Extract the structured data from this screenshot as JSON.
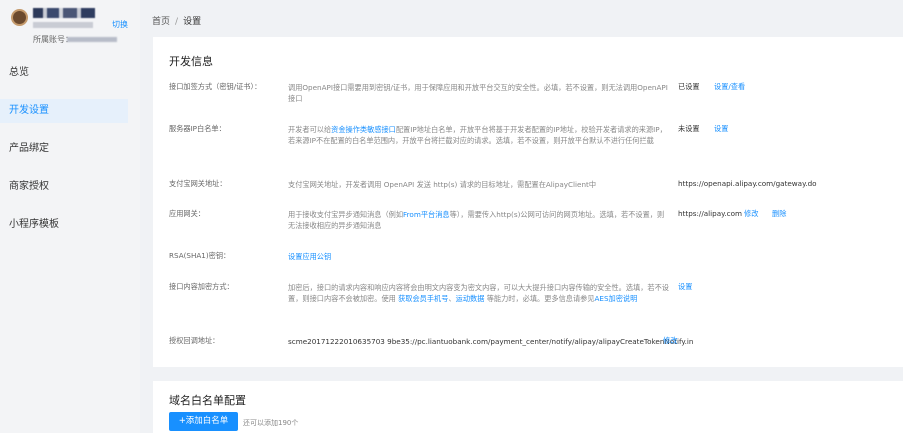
{
  "profile": {
    "switch_label": "切换",
    "account_label": "所属账号："
  },
  "nav": {
    "items": [
      {
        "label": "总览",
        "active": false
      },
      {
        "label": "开发设置",
        "active": true
      },
      {
        "label": "产品绑定",
        "active": false
      },
      {
        "label": "商家授权",
        "active": false
      },
      {
        "label": "小程序模板",
        "active": false
      }
    ]
  },
  "breadcrumb": {
    "home": "首页",
    "separator": "/",
    "current": "设置"
  },
  "dev_info": {
    "title": "开发信息",
    "rows": {
      "sign": {
        "label": "接口加签方式（密钥/证书）：",
        "desc": "调用OpenAPI接口需要用到密钥/证书，用于保障应用和开放平台交互的安全性。必填，若不设置，则无法调用OpenAPI接口",
        "status": "已设置",
        "action": "设置/查看"
      },
      "ip": {
        "label": "服务器IP白名单：",
        "desc_pre": "开发者可以给",
        "desc_link": "资金操作类敏感接口",
        "desc_post": "配置IP地址白名单，开放平台将基于开发者配置的IP地址，校验开发者请求的来源IP，若来源IP不在配置的白名单范围内，开放平台将拦截对应的请求。选填，若不设置，则开放平台默认不进行任何拦截",
        "status": "未设置",
        "action": "设置"
      },
      "gateway": {
        "label": "支付宝网关地址：",
        "desc": "支付宝网关地址，开发者调用 OpenAPI 发送 http(s) 请求的目标地址，需配置在AlipayClient中",
        "value": "https://openapi.alipay.com/gateway.do"
      },
      "app_gateway": {
        "label": "应用网关：",
        "desc_pre": "用于接收支付宝异步通知消息（例如",
        "desc_link": "From平台消息",
        "desc_post": "等），需要传入http(s)公网可访问的网页地址。选填，若不设置，则无法接收相应的异步通知消息",
        "value": "https://alipay.com",
        "action_edit": "修改",
        "action_delete": "删除"
      },
      "rsa": {
        "label": "RSA(SHA1)密钥：",
        "action": "设置应用公钥"
      },
      "encrypt": {
        "label": "接口内容加密方式：",
        "desc_1": "加密后，接口的请求内容和响应内容将会由明文内容变为密文内容，可以大大提升接口内容传输的安全性。选填，若不设置，则接口内容不会被加密。使用 ",
        "desc_link_1": "获取会员手机号",
        "desc_sep": "、",
        "desc_link_2": "运动数据",
        "desc_2": " 等能力时，必填。更多信息请参见",
        "desc_link_3": "AES加密说明",
        "action": "设置"
      },
      "callback": {
        "label": "授权回调地址：",
        "value": "scme20171222010635703 9be35://pc.liantuobank.com/payment_center/notify/alipay/alipayCreateTokenNotify.in",
        "action": "修改"
      }
    }
  },
  "domain_whitelist": {
    "title": "域名白名单配置",
    "add_button": "+添加白名单",
    "hint": "还可以添加190个"
  },
  "colors": {
    "accent": "#1890ff",
    "sidebar_bg": "#f3f4f6",
    "active_nav_bg": "#e6f0fb",
    "page_bg": "#f0f2f5"
  }
}
